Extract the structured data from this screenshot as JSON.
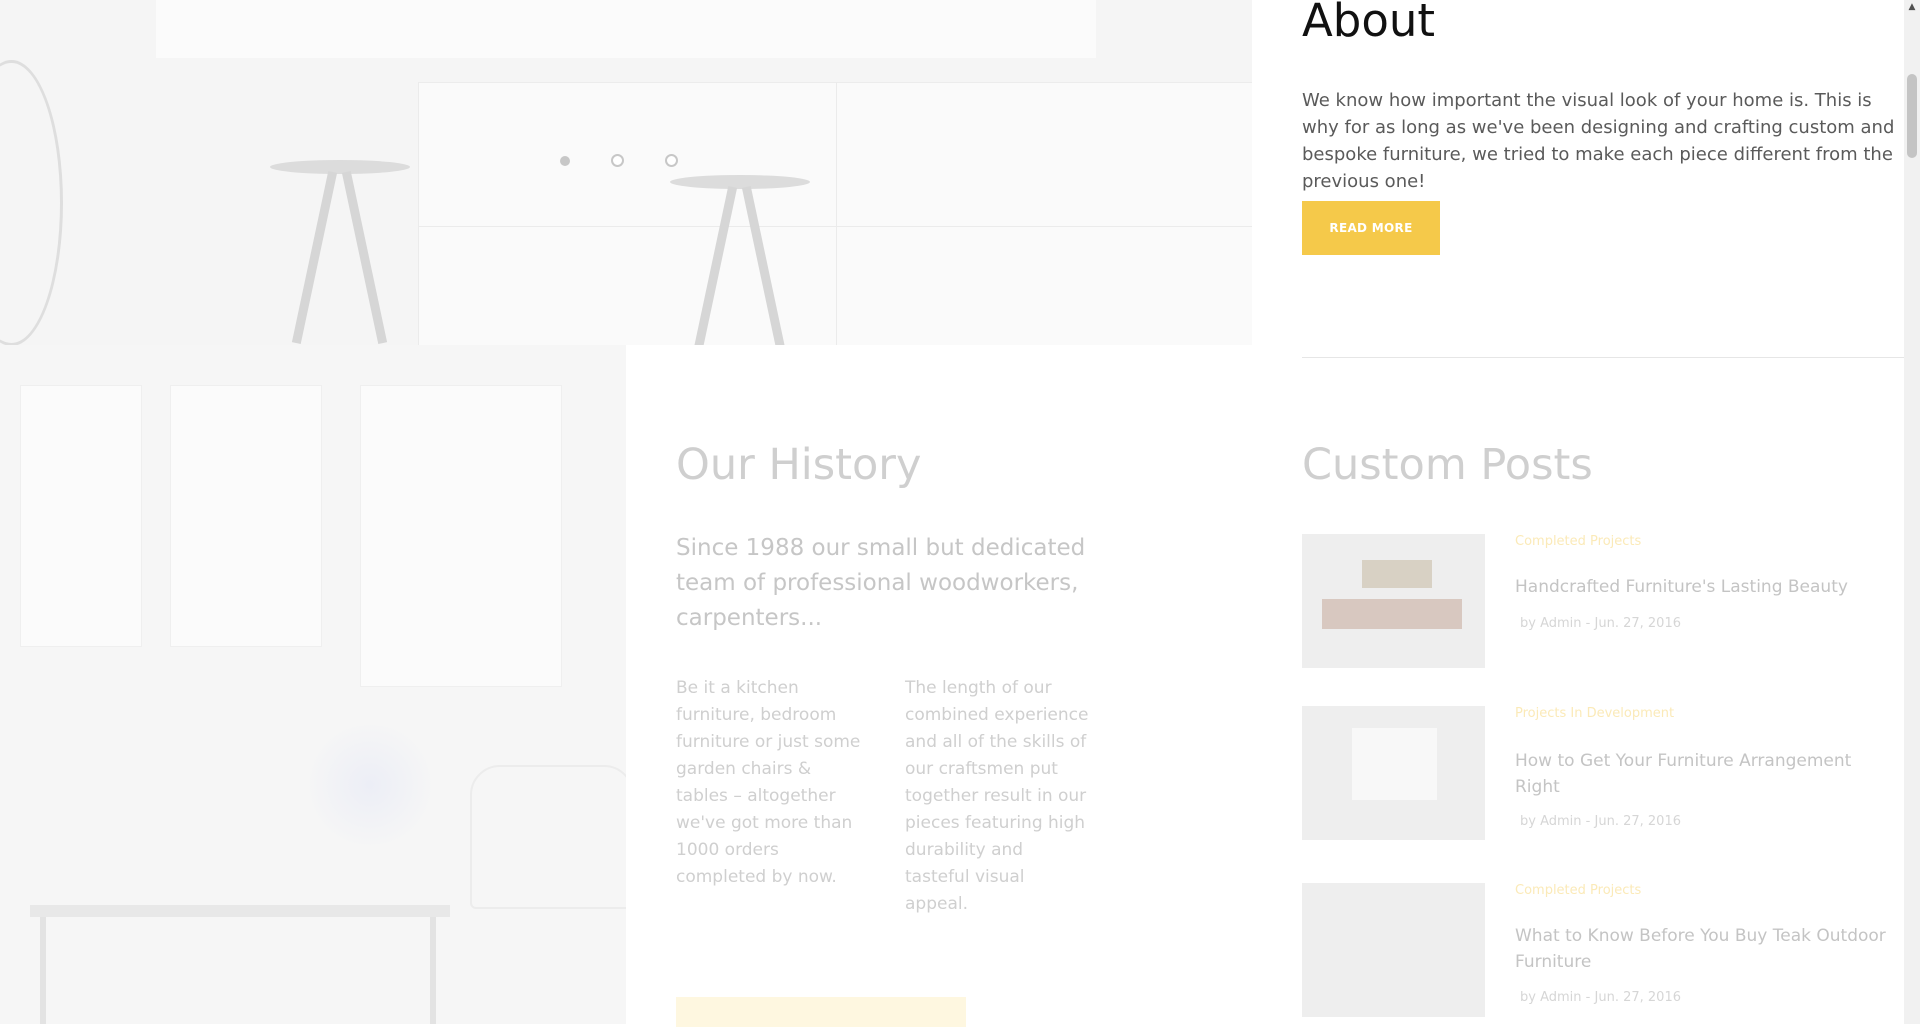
{
  "about": {
    "title": "About",
    "text": "We know how important the visual look of your home is. This is why for as long as we've been designing and crafting custom and bespoke furniture, we tried to make each piece different from the previous one!",
    "button": "READ MORE"
  },
  "history": {
    "title": "Our History",
    "lead": "Since 1988 our small but dedicated team of professional woodworkers, carpenters...",
    "col1": "Be it a kitchen furniture, bedroom furniture or just some garden chairs & tables – altogether we've got more than 1000 orders completed by now.",
    "col2": "The length of our combined experience and all of the skills of our craftsmen put together result in our pieces featuring high durability and tasteful visual appeal."
  },
  "posts": {
    "title": "Custom Posts",
    "items": [
      {
        "category": "Completed Projects",
        "title": "Handcrafted Furniture's Lasting Beauty",
        "author": "Admin",
        "date": "Jun. 27, 2016"
      },
      {
        "category": "Projects In Development",
        "title": "How to Get Your Furniture Arrangement Right",
        "author": "Admin",
        "date": "Jun. 27, 2016"
      },
      {
        "category": "Completed Projects",
        "title": "What to Know Before You Buy Teak Outdoor Furniture",
        "author": "Admin",
        "date": "Jun. 27, 2016"
      }
    ]
  },
  "slider": {
    "active_index": 0,
    "count": 3
  },
  "meta_prefix": "by",
  "meta_sep": "-",
  "colors": {
    "accent": "#f5c94a",
    "heading": "#111111",
    "text": "#5a5a5a"
  },
  "icons": {
    "scroll_up": "triangle-up-icon"
  }
}
